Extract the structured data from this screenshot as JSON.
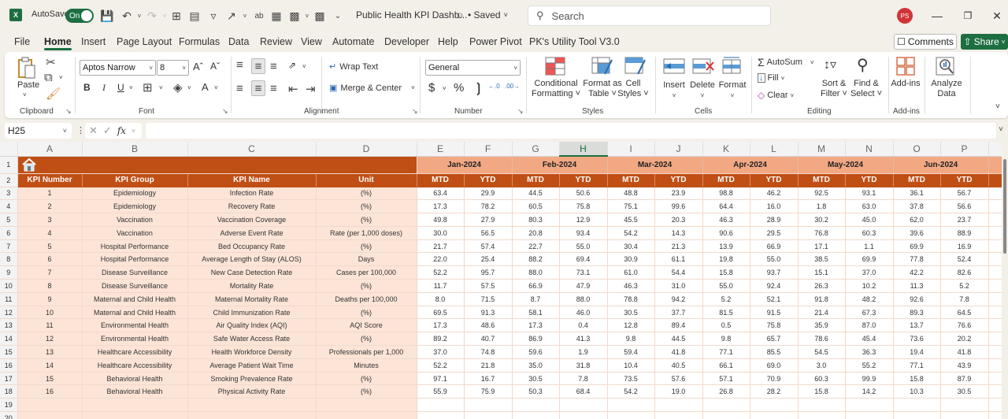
{
  "titlebar": {
    "autosave_label": "AutoSave",
    "autosave_state": "On",
    "document_title": "Public Health KPI Dashb...",
    "saved_status": "• Saved",
    "search_placeholder": "Search",
    "user_initials": "PS"
  },
  "menu": {
    "tabs": [
      "File",
      "Home",
      "Insert",
      "Page Layout",
      "Formulas",
      "Data",
      "Review",
      "View",
      "Automate",
      "Developer",
      "Help",
      "Power Pivot",
      "PK's Utility Tool V3.0"
    ],
    "active": "Home",
    "comments_label": "Comments",
    "share_label": "Share"
  },
  "ribbon": {
    "clipboard": {
      "paste_label": "Paste",
      "group_label": "Clipboard"
    },
    "font": {
      "font_name": "Aptos Narrow",
      "font_size": "8",
      "group_label": "Font",
      "bold": "B",
      "italic": "I",
      "underline": "U"
    },
    "alignment": {
      "wrap_text": "Wrap Text",
      "merge_center": "Merge & Center",
      "group_label": "Alignment"
    },
    "number": {
      "format": "General",
      "group_label": "Number"
    },
    "styles": {
      "conditional_formatting": [
        "Conditional",
        "Formatting ˅"
      ],
      "format_as_table": [
        "Format as",
        "Table ˅"
      ],
      "cell_styles": [
        "Cell",
        "Styles ˅"
      ],
      "group_label": "Styles"
    },
    "cells": {
      "insert": "Insert",
      "delete": "Delete",
      "format": "Format",
      "group_label": "Cells"
    },
    "editing": {
      "autosum": "AutoSum",
      "fill": "Fill",
      "clear": "Clear",
      "sort_filter": [
        "Sort &",
        "Filter ˅"
      ],
      "find_select": [
        "Find &",
        "Select ˅"
      ],
      "group_label": "Editing"
    },
    "addins": {
      "label": "Add-ins",
      "group_label": "Add-ins"
    },
    "analyze": {
      "label": [
        "Analyze",
        "Data"
      ]
    }
  },
  "formula_bar": {
    "name_box": "H25",
    "formula": ""
  },
  "sheet": {
    "columns": [
      "A",
      "B",
      "C",
      "D",
      "E",
      "F",
      "G",
      "H",
      "I",
      "J",
      "K",
      "L",
      "M",
      "N",
      "O",
      "P",
      ""
    ],
    "active_column": "H",
    "row_numbers": [
      "1",
      "2",
      "3",
      "4",
      "5",
      "6",
      "7",
      "8",
      "9",
      "10",
      "11",
      "12",
      "13",
      "14",
      "15",
      "16",
      "17",
      "18",
      "19",
      "20"
    ],
    "months": [
      "Jan-2024",
      "Feb-2024",
      "Mar-2024",
      "Apr-2024",
      "May-2024",
      "Jun-2024"
    ],
    "headers": [
      "KPI Number",
      "KPI Group",
      "KPI Name",
      "Unit"
    ],
    "sub_headers": [
      "MTD",
      "YTD"
    ],
    "colors": {
      "header_dark": "#c04f15",
      "header_light": "#f2a883",
      "left_fill": "#fce4d6"
    },
    "rows": [
      {
        "num": "1",
        "group": "Epidemiology",
        "name": "Infection Rate",
        "unit": "(%)",
        "values": [
          "63.4",
          "29.9",
          "44.5",
          "50.6",
          "48.8",
          "23.9",
          "98.8",
          "46.2",
          "92.5",
          "93.1",
          "36.1",
          "56.7"
        ]
      },
      {
        "num": "2",
        "group": "Epidemiology",
        "name": "Recovery Rate",
        "unit": "(%)",
        "values": [
          "17.3",
          "78.2",
          "60.5",
          "75.8",
          "75.1",
          "99.6",
          "64.4",
          "16.0",
          "1.8",
          "63.0",
          "37.8",
          "56.6"
        ]
      },
      {
        "num": "3",
        "group": "Vaccination",
        "name": "Vaccination Coverage",
        "unit": "(%)",
        "values": [
          "49.8",
          "27.9",
          "80.3",
          "12.9",
          "45.5",
          "20.3",
          "46.3",
          "28.9",
          "30.2",
          "45.0",
          "62.0",
          "23.7"
        ]
      },
      {
        "num": "4",
        "group": "Vaccination",
        "name": "Adverse Event Rate",
        "unit": "Rate (per 1,000 doses)",
        "values": [
          "30.0",
          "56.5",
          "20.8",
          "93.4",
          "54.2",
          "14.3",
          "90.6",
          "29.5",
          "76.8",
          "60.3",
          "39.6",
          "88.9"
        ]
      },
      {
        "num": "5",
        "group": "Hospital Performance",
        "name": "Bed Occupancy Rate",
        "unit": "(%)",
        "values": [
          "21.7",
          "57.4",
          "22.7",
          "55.0",
          "30.4",
          "21.3",
          "13.9",
          "66.9",
          "17.1",
          "1.1",
          "69.9",
          "16.9"
        ]
      },
      {
        "num": "6",
        "group": "Hospital Performance",
        "name": "Average Length of Stay (ALOS)",
        "unit": "Days",
        "values": [
          "22.0",
          "25.4",
          "88.2",
          "69.4",
          "30.9",
          "61.1",
          "19.8",
          "55.0",
          "38.5",
          "69.9",
          "77.8",
          "52.4"
        ]
      },
      {
        "num": "7",
        "group": "Disease Surveillance",
        "name": "New Case Detection Rate",
        "unit": "Cases per 100,000",
        "values": [
          "52.2",
          "95.7",
          "88.0",
          "73.1",
          "61.0",
          "54.4",
          "15.8",
          "93.7",
          "15.1",
          "37.0",
          "42.2",
          "82.6"
        ]
      },
      {
        "num": "8",
        "group": "Disease Surveillance",
        "name": "Mortality Rate",
        "unit": "(%)",
        "values": [
          "11.7",
          "57.5",
          "66.9",
          "47.9",
          "46.3",
          "31.0",
          "55.0",
          "92.4",
          "26.3",
          "10.2",
          "11.3",
          "5.2"
        ]
      },
      {
        "num": "9",
        "group": "Maternal and Child Health",
        "name": "Maternal Mortality Rate",
        "unit": "Deaths per 100,000",
        "values": [
          "8.0",
          "71.5",
          "8.7",
          "88.0",
          "78.8",
          "94.2",
          "5.2",
          "52.1",
          "91.8",
          "48.2",
          "92.6",
          "7.8"
        ]
      },
      {
        "num": "10",
        "group": "Maternal and Child Health",
        "name": "Child Immunization Rate",
        "unit": "(%)",
        "values": [
          "69.5",
          "91.3",
          "58.1",
          "46.0",
          "30.5",
          "37.7",
          "81.5",
          "91.5",
          "21.4",
          "67.3",
          "89.3",
          "64.5"
        ]
      },
      {
        "num": "11",
        "group": "Environmental Health",
        "name": "Air Quality Index (AQI)",
        "unit": "AQI Score",
        "values": [
          "17.3",
          "48.6",
          "17.3",
          "0.4",
          "12.8",
          "89.4",
          "0.5",
          "75.8",
          "35.9",
          "87.0",
          "13.7",
          "76.6"
        ]
      },
      {
        "num": "12",
        "group": "Environmental Health",
        "name": "Safe Water Access Rate",
        "unit": "(%)",
        "values": [
          "89.2",
          "40.7",
          "86.9",
          "41.3",
          "9.8",
          "44.5",
          "9.8",
          "65.7",
          "78.6",
          "45.4",
          "73.6",
          "20.2"
        ]
      },
      {
        "num": "13",
        "group": "Healthcare Accessibility",
        "name": "Health Workforce Density",
        "unit": "Professionals per 1,000",
        "values": [
          "37.0",
          "74.8",
          "59.6",
          "1.9",
          "59.4",
          "41.8",
          "77.1",
          "85.5",
          "54.5",
          "36.3",
          "19.4",
          "41.8"
        ]
      },
      {
        "num": "14",
        "group": "Healthcare Accessibility",
        "name": "Average Patient Wait Time",
        "unit": "Minutes",
        "values": [
          "52.2",
          "21.8",
          "35.0",
          "31.8",
          "10.4",
          "40.5",
          "66.1",
          "69.0",
          "3.0",
          "55.2",
          "77.1",
          "43.9"
        ]
      },
      {
        "num": "15",
        "group": "Behavioral Health",
        "name": "Smoking Prevalence Rate",
        "unit": "(%)",
        "values": [
          "97.1",
          "16.7",
          "30.5",
          "7.8",
          "73.5",
          "57.6",
          "57.1",
          "70.9",
          "60.3",
          "99.9",
          "15.8",
          "87.9"
        ]
      },
      {
        "num": "16",
        "group": "Behavioral Health",
        "name": "Physical Activity Rate",
        "unit": "(%)",
        "values": [
          "55.9",
          "75.9",
          "50.3",
          "68.4",
          "54.2",
          "19.0",
          "26.8",
          "28.2",
          "15.8",
          "14.2",
          "10.3",
          "30.5"
        ]
      }
    ]
  }
}
